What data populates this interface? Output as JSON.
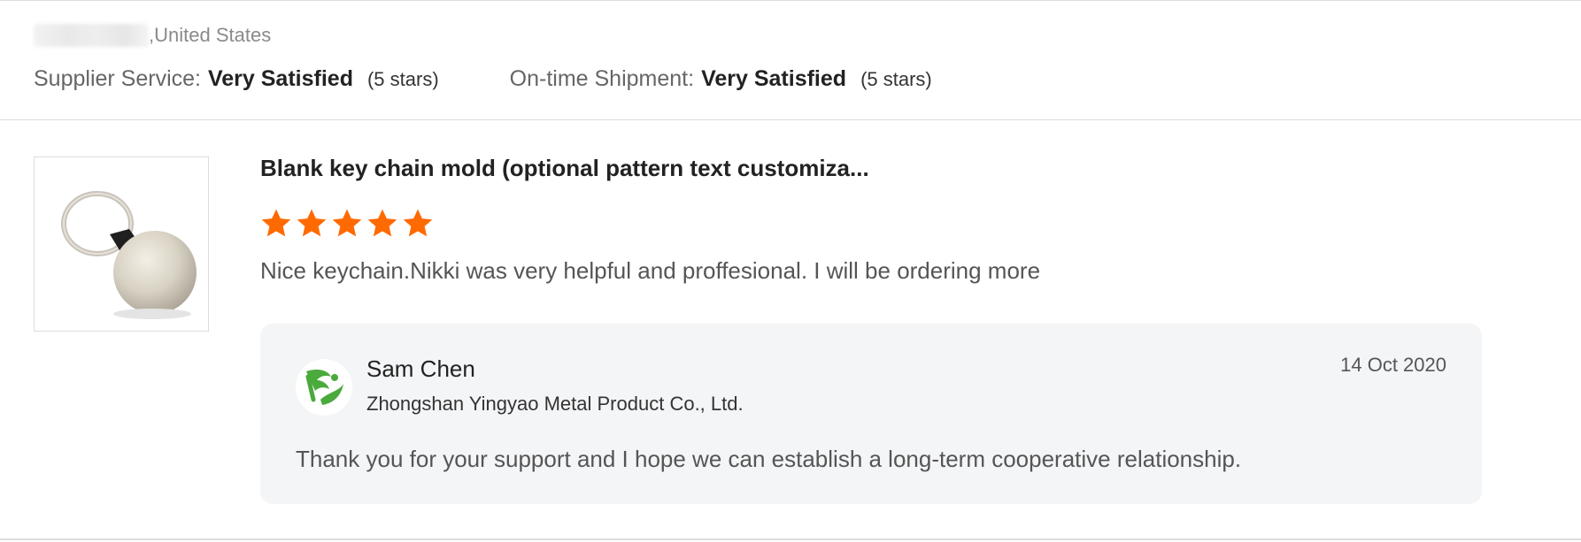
{
  "reviewer": {
    "location": ",United States"
  },
  "ratings": {
    "supplier_service": {
      "label": "Supplier Service:",
      "value": "Very Satisfied",
      "stars": "(5 stars)"
    },
    "ontime_shipment": {
      "label": "On-time Shipment:",
      "value": "Very Satisfied",
      "stars": "(5 stars)"
    }
  },
  "review": {
    "product_title": "Blank key chain mold (optional pattern text customiza...",
    "rating": 5,
    "text": "Nice keychain.Nikki was very helpful and proffesional. I will be ordering more"
  },
  "reply": {
    "name": "Sam Chen",
    "company": "Zhongshan Yingyao Metal Product Co., Ltd.",
    "date": "14 Oct 2020",
    "text": "Thank you for your support and I hope we can establish a long-term cooperative relationship."
  },
  "colors": {
    "star": "#ff6a00",
    "brand_logo": "#4aaa3c",
    "reply_bg": "#f4f5f7"
  },
  "icons": {
    "avatar": "company-logo-icon",
    "star": "star-icon",
    "product": "keychain-product-image"
  }
}
